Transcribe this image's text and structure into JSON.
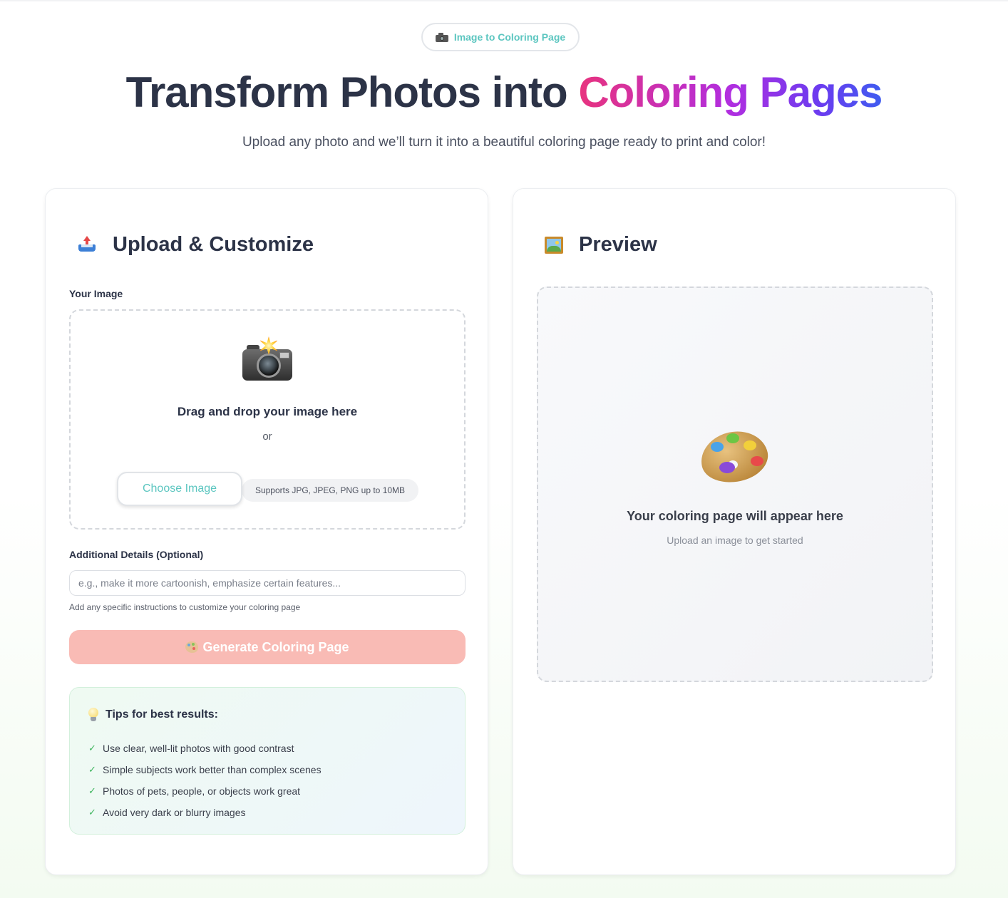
{
  "badge": {
    "icon": "camera-icon",
    "label": "Image to Coloring Page"
  },
  "hero": {
    "title_plain": "Transform Photos into ",
    "title_highlight": "Coloring Pages",
    "subtitle": "Upload any photo and we’ll turn it into a beautiful coloring page ready to print and color!",
    "gradient_colors": [
      "#e8337e",
      "#b12ee0",
      "#3f5cf0"
    ]
  },
  "upload_card": {
    "icon": "inbox-tray-icon",
    "heading": "Upload & Customize",
    "image_label": "Your Image",
    "dropzone": {
      "icon": "camera-flash-icon",
      "text": "Drag and drop your image here",
      "or": "or",
      "button": "Choose Image",
      "supports": "Supports JPG, JPEG, PNG up to 10MB"
    },
    "details_label": "Additional Details (Optional)",
    "details_placeholder": "e.g., make it more cartoonish, emphasize certain features...",
    "details_value": "",
    "details_hint": "Add any specific instructions to customize your coloring page",
    "generate_button": "Generate Coloring Page",
    "generate_icon": "palette-icon",
    "accent_color": "#5cc6c0",
    "generate_color": "#f9bbb5",
    "tips": {
      "icon": "light-bulb-icon",
      "title": "Tips for best results:",
      "items": [
        "Use clear, well-lit photos with good contrast",
        "Simple subjects work better than complex scenes",
        "Photos of pets, people, or objects work great",
        "Avoid very dark or blurry images"
      ]
    }
  },
  "preview_card": {
    "icon": "framed-picture-icon",
    "heading": "Preview",
    "empty_icon": "artist-palette-icon",
    "empty_title": "Your coloring page will appear here",
    "empty_subtitle": "Upload an image to get started"
  }
}
